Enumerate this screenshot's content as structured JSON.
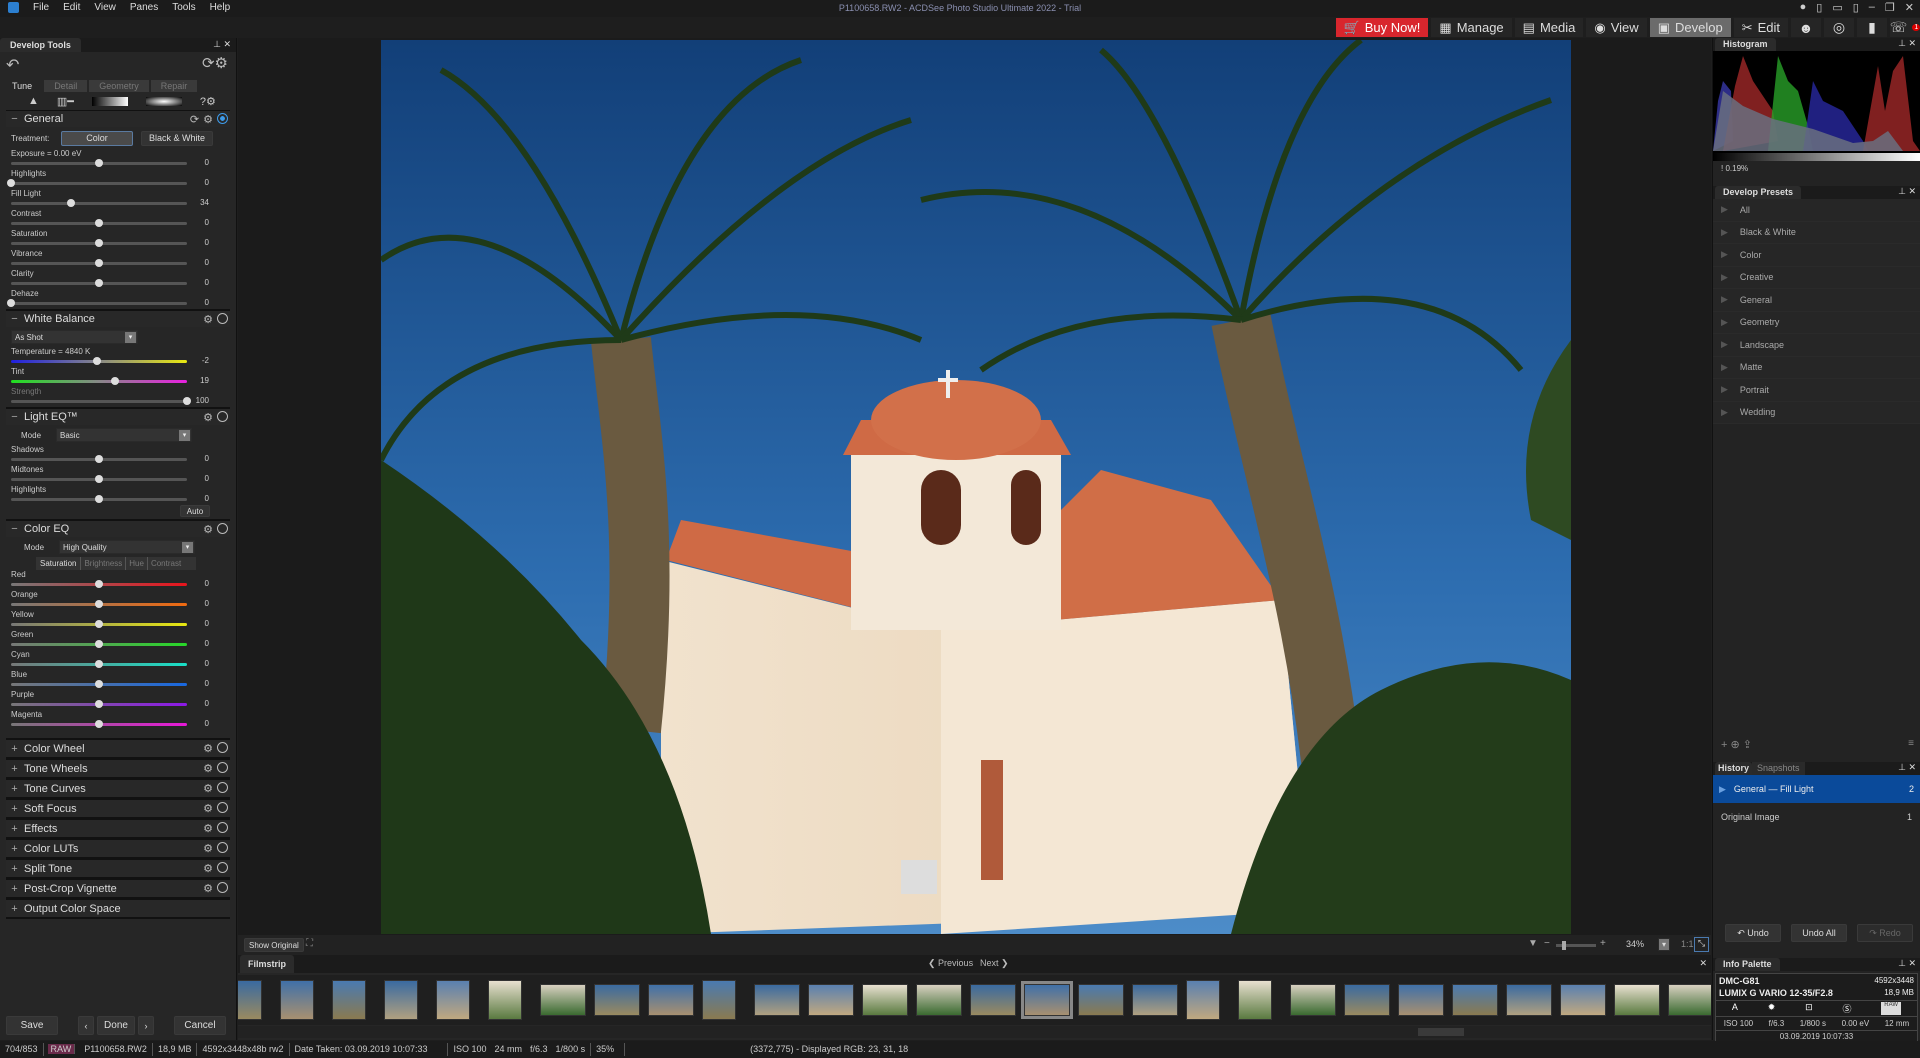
{
  "app": {
    "title": "P1100658.RW2 - ACDSee Photo Studio Ultimate 2022 - Trial",
    "menu": [
      "File",
      "Edit",
      "View",
      "Panes",
      "Tools",
      "Help"
    ]
  },
  "modes": {
    "buy": "Buy Now!",
    "manage": "Manage",
    "media": "Media",
    "view": "View",
    "develop": "Develop",
    "edit": "Edit",
    "notification_count": "1",
    "active": "Develop"
  },
  "develop_tools": {
    "title": "Develop Tools",
    "tabs": [
      "Tune",
      "Detail",
      "Geometry",
      "Repair"
    ],
    "active_tab": "Tune",
    "general": {
      "title": "General",
      "treatment_label": "Treatment:",
      "treatment_options": [
        "Color",
        "Black & White"
      ],
      "treatment_selected": "Color",
      "sliders": [
        {
          "label": "Exposure = 0.00 eV",
          "value": "0",
          "pos": 0.5
        },
        {
          "label": "Highlights",
          "value": "0",
          "pos": 0
        },
        {
          "label": "Fill Light",
          "value": "34",
          "pos": 0.34
        },
        {
          "label": "Contrast",
          "value": "0",
          "pos": 0.5
        },
        {
          "label": "Saturation",
          "value": "0",
          "pos": 0.5
        },
        {
          "label": "Vibrance",
          "value": "0",
          "pos": 0.5
        },
        {
          "label": "Clarity",
          "value": "0",
          "pos": 0.5
        },
        {
          "label": "Dehaze",
          "value": "0",
          "pos": 0
        }
      ]
    },
    "white_balance": {
      "title": "White Balance",
      "preset": "As Shot",
      "sliders": [
        {
          "label": "Temperature = 4840 K",
          "value": "-2",
          "pos": 0.49
        },
        {
          "label": "Tint",
          "value": "19",
          "pos": 0.59
        },
        {
          "label": "Strength",
          "value": "100",
          "pos": 1
        }
      ]
    },
    "light_eq": {
      "title": "Light EQ™",
      "mode_label": "Mode",
      "mode": "Basic",
      "sliders": [
        {
          "label": "Shadows",
          "value": "0",
          "pos": 0.5
        },
        {
          "label": "Midtones",
          "value": "0",
          "pos": 0.5
        },
        {
          "label": "Highlights",
          "value": "0",
          "pos": 0.5
        }
      ],
      "auto": "Auto"
    },
    "color_eq": {
      "title": "Color EQ",
      "mode_label": "Mode",
      "mode": "High Quality",
      "tabs": [
        "Saturation",
        "Brightness",
        "Hue",
        "Contrast"
      ],
      "active_tab": "Saturation",
      "sliders": [
        {
          "label": "Red",
          "value": "0",
          "pos": 0.5,
          "color": "#e8141c"
        },
        {
          "label": "Orange",
          "value": "0",
          "pos": 0.5,
          "color": "#f06a10"
        },
        {
          "label": "Yellow",
          "value": "0",
          "pos": 0.5,
          "color": "#e8e810"
        },
        {
          "label": "Green",
          "value": "0",
          "pos": 0.5,
          "color": "#28d828"
        },
        {
          "label": "Cyan",
          "value": "0",
          "pos": 0.5,
          "color": "#18e0c8"
        },
        {
          "label": "Blue",
          "value": "0",
          "pos": 0.5,
          "color": "#1868e0"
        },
        {
          "label": "Purple",
          "value": "0",
          "pos": 0.5,
          "color": "#8c18e8"
        },
        {
          "label": "Magenta",
          "value": "0",
          "pos": 0.5,
          "color": "#e818d8"
        }
      ]
    },
    "collapsed": [
      "Color Wheel",
      "Tone Wheels",
      "Tone Curves",
      "Soft Focus",
      "Effects",
      "Color LUTs",
      "Split Tone",
      "Post-Crop Vignette",
      "Output Color Space"
    ],
    "buttons": {
      "save": "Save",
      "done": "Done",
      "cancel": "Cancel"
    }
  },
  "viewer": {
    "show_original": "Show Original",
    "zoom": "34%",
    "one_to_one": "1:1"
  },
  "filmstrip": {
    "title": "Filmstrip",
    "previous": "Previous",
    "next": "Next"
  },
  "histogram": {
    "title": "Histogram",
    "clip": "0.19%"
  },
  "presets": {
    "title": "Develop Presets",
    "items": [
      "All",
      "Black & White",
      "Color",
      "Creative",
      "General",
      "Geometry",
      "Landscape",
      "Matte",
      "Portrait",
      "Wedding"
    ]
  },
  "history": {
    "tabs": [
      "History",
      "Snapshots"
    ],
    "items": [
      {
        "label": "General — Fill Light",
        "num": "2"
      },
      {
        "label": "Original Image",
        "num": "1"
      }
    ],
    "undo": "Undo",
    "undo_all": "Undo All",
    "redo": "Redo"
  },
  "info": {
    "title": "Info Palette",
    "camera": "DMC-G81",
    "lens": "LUMIX G VARIO 12-35/F2.8",
    "dims": "4592x3448",
    "size": "18,9 MB",
    "mode": "A",
    "raw": "RAW",
    "iso": "ISO 100",
    "aperture": "f/6.3",
    "shutter": "1/800 s",
    "ev": "0.00 eV",
    "focal": "12 mm",
    "date": "03.09.2019 10:07:33"
  },
  "status": {
    "index": "704/853",
    "type": "RAW",
    "file": "P1100658.RW2",
    "size": "18,9 MB",
    "dims": "4592x3448x48b rw2",
    "date": "Date Taken: 03.09.2019 10:07:33",
    "iso": "ISO 100",
    "focal": "24 mm",
    "aperture": "f/6.3",
    "shutter": "1/800 s",
    "zoom": "35%",
    "pixel": "(3372,775) - Displayed RGB: 23, 31, 18"
  }
}
